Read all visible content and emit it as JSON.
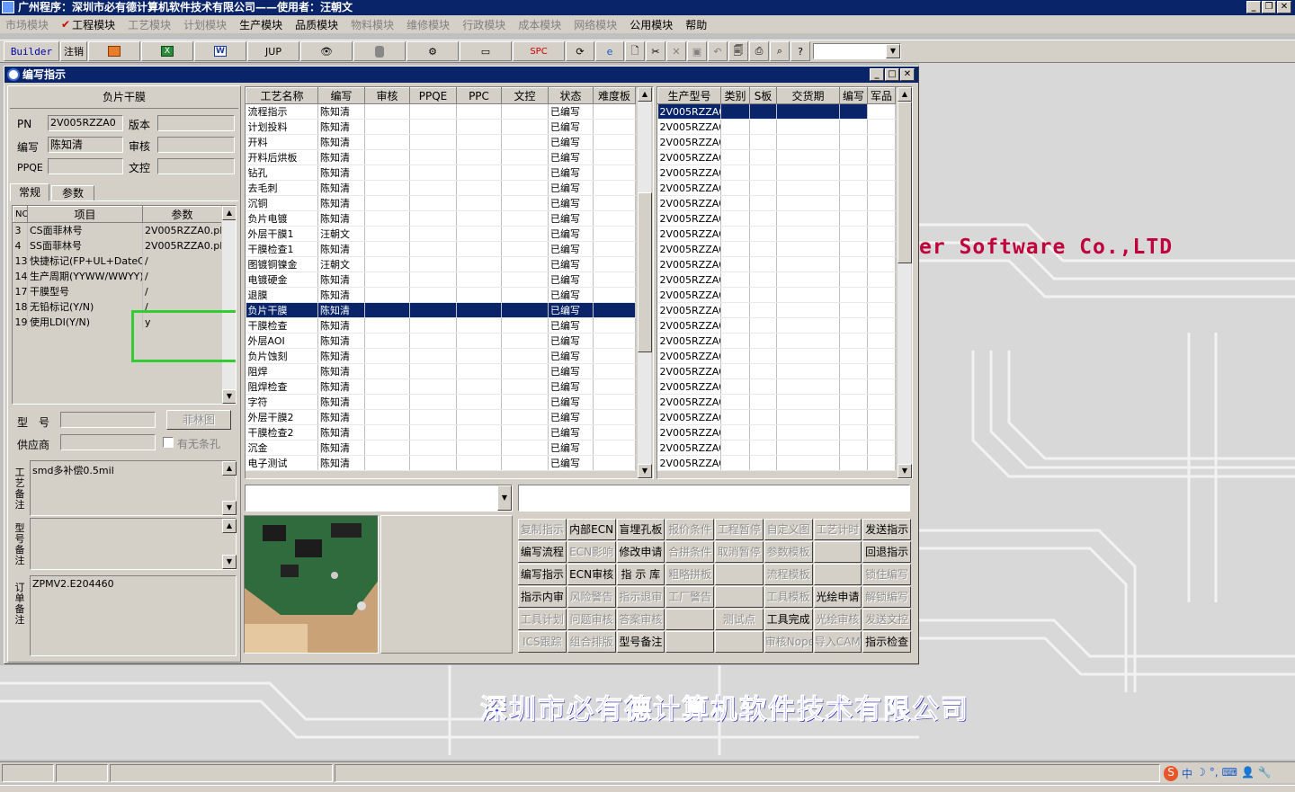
{
  "app_title": "广州程序：深圳市必有德计算机软件技术有限公司——使用者：汪朝文",
  "menu": [
    {
      "label": "市场模块",
      "enabled": false
    },
    {
      "label": "工程模块",
      "enabled": true,
      "checked": true
    },
    {
      "label": "工艺模块",
      "enabled": false
    },
    {
      "label": "计划模块",
      "enabled": false
    },
    {
      "label": "生产模块",
      "enabled": true
    },
    {
      "label": "品质模块",
      "enabled": true
    },
    {
      "label": "物料模块",
      "enabled": false
    },
    {
      "label": "维修模块",
      "enabled": false
    },
    {
      "label": "行政模块",
      "enabled": false
    },
    {
      "label": "成本模块",
      "enabled": false
    },
    {
      "label": "网络模块",
      "enabled": false
    },
    {
      "label": "公用模块",
      "enabled": true
    },
    {
      "label": "帮助",
      "enabled": true
    }
  ],
  "toolbar": {
    "builder": "Builder",
    "logout": "注销",
    "jup": "JUP",
    "spc": "SPC"
  },
  "window": {
    "title": "编写指示"
  },
  "left": {
    "heading": "负片干膜",
    "pn_label": "PN",
    "pn_value": "2V005RZZA0",
    "version_label": "版本",
    "version_value": "",
    "writer_label": "编写",
    "writer_value": "陈知清",
    "audit_label": "审核",
    "audit_value": "",
    "ppqe_label": "PPQE",
    "ppqe_value": "",
    "doc_label": "文控",
    "doc_value": "",
    "tabs": [
      "常规",
      "参数"
    ],
    "param_headers": [
      "NO",
      "项目",
      "参数"
    ],
    "params": [
      {
        "no": "3",
        "item": "CS面菲林号",
        "value": "2V005RZZA0.plr"
      },
      {
        "no": "4",
        "item": "SS面菲林号",
        "value": "2V005RZZA0.plr"
      },
      {
        "no": "13",
        "item": "快捷标记(FP+UL+DateC",
        "value": "/"
      },
      {
        "no": "14",
        "item": "生产周期(YYWW/WWYY)",
        "value": "/"
      },
      {
        "no": "17",
        "item": "干膜型号",
        "value": "/"
      },
      {
        "no": "18",
        "item": "无铅标记(Y/N)",
        "value": "/"
      },
      {
        "no": "19",
        "item": "使用LDI(Y/N)",
        "value": "y"
      }
    ],
    "model_label": "型　号",
    "model_value": "",
    "film_button": "菲林图",
    "supplier_label": "供应商",
    "supplier_value": "",
    "stripe_hole": "有无条孔",
    "craft_note_label": "工艺备注",
    "craft_note": "smd多补偿0.5mil",
    "model_note_label": "型号备注",
    "model_note": "",
    "order_note_label": "订单备注",
    "order_note": "ZPMV2.E204460"
  },
  "process": {
    "headers": [
      "工艺名称",
      "编写",
      "审核",
      "PPQE",
      "PPC",
      "文控",
      "状态",
      "难度板"
    ],
    "rows": [
      {
        "name": "流程指示",
        "writer": "陈知清",
        "status": "已编写"
      },
      {
        "name": "计划投料",
        "writer": "陈知清",
        "status": "已编写"
      },
      {
        "name": "开料",
        "writer": "陈知清",
        "status": "已编写"
      },
      {
        "name": "开料后烘板",
        "writer": "陈知清",
        "status": "已编写"
      },
      {
        "name": "钻孔",
        "writer": "陈知清",
        "status": "已编写"
      },
      {
        "name": "去毛刺",
        "writer": "陈知清",
        "status": "已编写"
      },
      {
        "name": "沉铜",
        "writer": "陈知清",
        "status": "已编写"
      },
      {
        "name": "负片电镀",
        "writer": "陈知清",
        "status": "已编写"
      },
      {
        "name": "外层干膜1",
        "writer": "汪朝文",
        "status": "已编写"
      },
      {
        "name": "干膜检查1",
        "writer": "陈知清",
        "status": "已编写"
      },
      {
        "name": "图镀铜镍金",
        "writer": "汪朝文",
        "status": "已编写"
      },
      {
        "name": "电镀硬金",
        "writer": "陈知清",
        "status": "已编写"
      },
      {
        "name": "退膜",
        "writer": "陈知清",
        "status": "已编写"
      },
      {
        "name": "负片干膜",
        "writer": "陈知清",
        "status": "已编写",
        "selected": true
      },
      {
        "name": "干膜检查",
        "writer": "陈知清",
        "status": "已编写"
      },
      {
        "name": "外层AOI",
        "writer": "陈知清",
        "status": "已编写"
      },
      {
        "name": "负片蚀刻",
        "writer": "陈知清",
        "status": "已编写"
      },
      {
        "name": "阻焊",
        "writer": "陈知清",
        "status": "已编写"
      },
      {
        "name": "阻焊检查",
        "writer": "陈知清",
        "status": "已编写"
      },
      {
        "name": "字符",
        "writer": "陈知清",
        "status": "已编写"
      },
      {
        "name": "外层干膜2",
        "writer": "陈知清",
        "status": "已编写"
      },
      {
        "name": "干膜检查2",
        "writer": "陈知清",
        "status": "已编写"
      },
      {
        "name": "沉金",
        "writer": "陈知清",
        "status": "已编写"
      },
      {
        "name": "电子测试",
        "writer": "陈知清",
        "status": "已编写"
      }
    ]
  },
  "production": {
    "headers": [
      "生产型号",
      "类别",
      "S板",
      "交货期",
      "编写",
      "军品"
    ],
    "rows": [
      "2V005RZZA0",
      "2V005RZZA0",
      "2V005RZZA0",
      "2V005RZZA0",
      "2V005RZZA0",
      "2V005RZZA0",
      "2V005RZZA0",
      "2V005RZZA0",
      "2V005RZZA0",
      "2V005RZZA0",
      "2V005RZZA0",
      "2V005RZZA0",
      "2V005RZZA0",
      "2V005RZZA0",
      "2V005RZZA0",
      "2V005RZZA0",
      "2V005RZZA0",
      "2V005RZZA0",
      "2V005RZZA0",
      "2V005RZZA0",
      "2V005RZZA0",
      "2V005RZZA0",
      "2V005RZZA0",
      "2V005RZZA0"
    ]
  },
  "actions": [
    [
      {
        "label": "复制指示",
        "enabled": false
      },
      {
        "label": "内部ECN",
        "enabled": true
      },
      {
        "label": "盲埋孔板",
        "enabled": true
      },
      {
        "label": "报价条件",
        "enabled": false
      },
      {
        "label": "工程暂停",
        "enabled": false
      },
      {
        "label": "自定义图",
        "enabled": false
      },
      {
        "label": "工艺计时",
        "enabled": false
      },
      {
        "label": "发送指示",
        "enabled": true
      }
    ],
    [
      {
        "label": "编写流程",
        "enabled": true
      },
      {
        "label": "ECN影响",
        "enabled": false
      },
      {
        "label": "修改申请",
        "enabled": true
      },
      {
        "label": "合拼条件",
        "enabled": false
      },
      {
        "label": "取消暂停",
        "enabled": false
      },
      {
        "label": "参数模板",
        "enabled": false
      },
      {
        "label": "",
        "enabled": false
      },
      {
        "label": "回退指示",
        "enabled": true
      }
    ],
    [
      {
        "label": "编写指示",
        "enabled": true
      },
      {
        "label": "ECN审核",
        "enabled": true
      },
      {
        "label": "指 示 库",
        "enabled": true
      },
      {
        "label": "粗略拼板",
        "enabled": false
      },
      {
        "label": "",
        "enabled": false
      },
      {
        "label": "流程模板",
        "enabled": false
      },
      {
        "label": "",
        "enabled": false
      },
      {
        "label": "锁住编写",
        "enabled": false
      }
    ],
    [
      {
        "label": "指示内审",
        "enabled": true
      },
      {
        "label": "风险警告",
        "enabled": false
      },
      {
        "label": "指示退审",
        "enabled": false
      },
      {
        "label": "工厂警告",
        "enabled": false
      },
      {
        "label": "",
        "enabled": false
      },
      {
        "label": "工具模板",
        "enabled": false
      },
      {
        "label": "光绘申请",
        "enabled": true
      },
      {
        "label": "解锁编写",
        "enabled": false
      }
    ],
    [
      {
        "label": "工具计划",
        "enabled": false
      },
      {
        "label": "问题审核",
        "enabled": false
      },
      {
        "label": "答案审核",
        "enabled": false
      },
      {
        "label": "",
        "enabled": false
      },
      {
        "label": "测试点",
        "enabled": false
      },
      {
        "label": "工具完成",
        "enabled": true
      },
      {
        "label": "光绘审核",
        "enabled": false
      },
      {
        "label": "发送文控",
        "enabled": false
      }
    ],
    [
      {
        "label": "ICS跟踪",
        "enabled": false
      },
      {
        "label": "组合排版",
        "enabled": false
      },
      {
        "label": "型号备注",
        "enabled": true
      },
      {
        "label": "",
        "enabled": false
      },
      {
        "label": "",
        "enabled": false
      },
      {
        "label": "审核Nope",
        "enabled": false
      },
      {
        "label": "导入CAM",
        "enabled": false
      },
      {
        "label": "指示检查",
        "enabled": true
      }
    ]
  ],
  "watermark_en": "er Software Co.,LTD",
  "watermark_cn": "深圳市必有德计算机软件技术有限公司",
  "colors": {
    "title_bar": "#0a246a",
    "selection": "#0a246a",
    "highlight_box": "#33cc33",
    "watermark_en": "#c0003c",
    "watermark_cn": "#3838ff"
  }
}
